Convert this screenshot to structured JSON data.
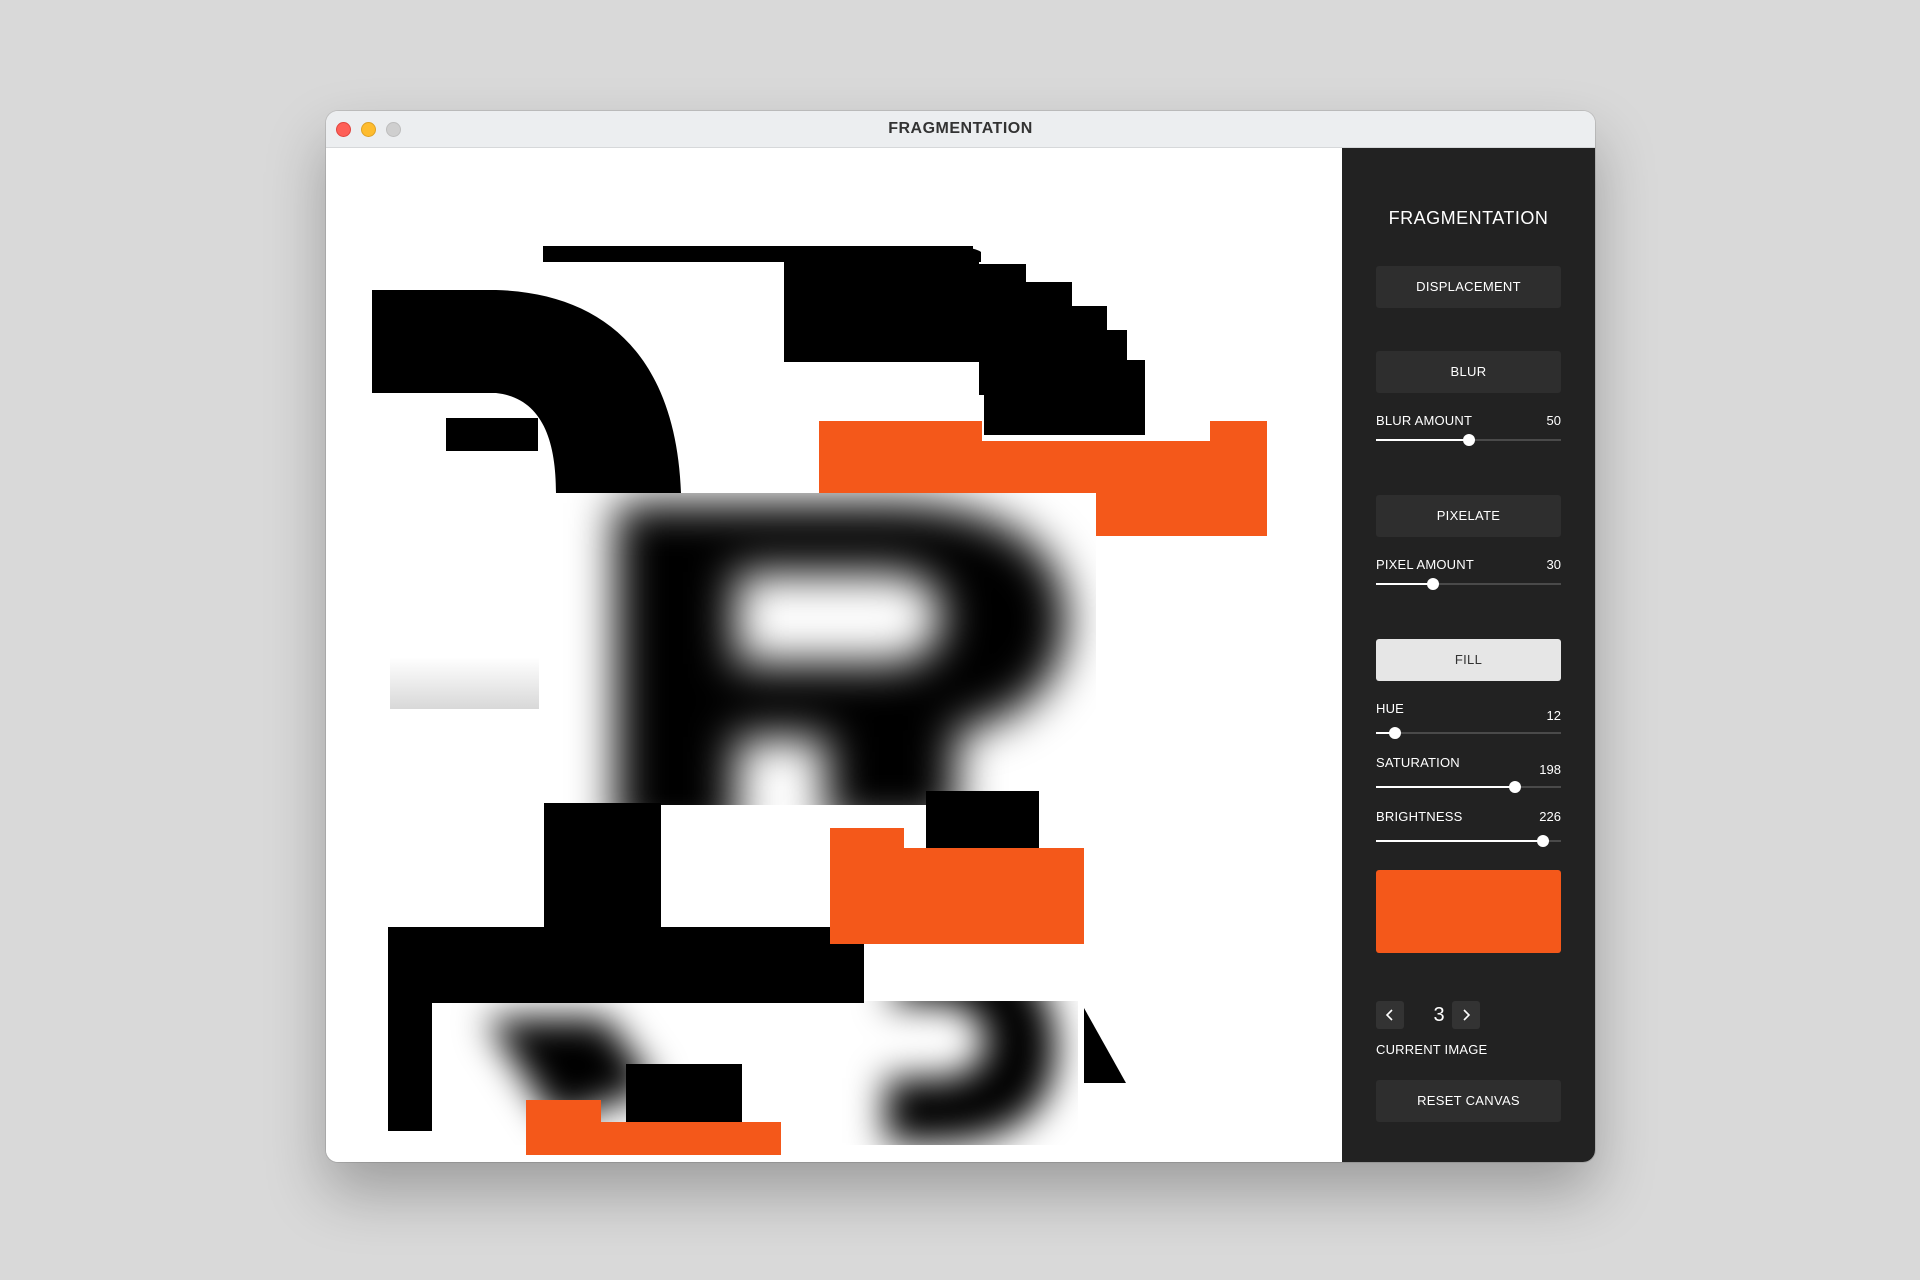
{
  "window": {
    "title": "FRAGMENTATION"
  },
  "panel": {
    "title": "FRAGMENTATION",
    "displacement_label": "DISPLACEMENT",
    "blur_label": "BLUR",
    "blur_amount": {
      "label": "BLUR AMOUNT",
      "value": "50",
      "fraction": 0.5
    },
    "pixelate_label": "PIXELATE",
    "pixel_amount": {
      "label": "PIXEL AMOUNT",
      "value": "30",
      "fraction": 0.31
    },
    "fill_label": "FILL",
    "hue": {
      "label": "HUE",
      "value": "12",
      "fraction": 0.1
    },
    "saturation": {
      "label": "SATURATION",
      "value": "198",
      "fraction": 0.75
    },
    "brightness": {
      "label": "BRIGHTNESS",
      "value": "226",
      "fraction": 0.9
    },
    "fill_color": "#f4581a",
    "current_image": {
      "value": "3",
      "label": "CURRENT IMAGE"
    },
    "reset_label": "RESET CANVAS"
  },
  "colors": {
    "accent": "#f4581a",
    "panel_bg": "#222222",
    "button_bg": "#2e2e2e",
    "active_button_bg": "#e6e6e6"
  },
  "icons": {
    "prev": "chevron-left-icon",
    "next": "chevron-right-icon"
  }
}
